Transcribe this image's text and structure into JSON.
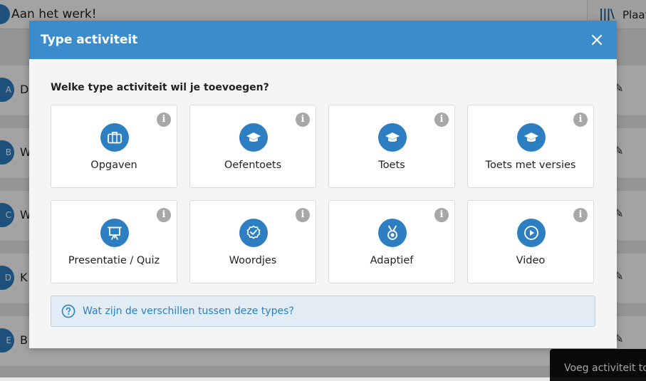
{
  "background": {
    "title": "Aan het werk!",
    "right_panel_label": "Plaat",
    "right_panel_icon": "library-icon",
    "rows": [
      {
        "initial": "A",
        "text": "D"
      },
      {
        "initial": "B",
        "text": "W"
      },
      {
        "initial": "C",
        "text": "W"
      },
      {
        "initial": "D",
        "text": "K"
      },
      {
        "initial": "E",
        "text": "B"
      }
    ],
    "toast": "Voeg activiteit to"
  },
  "modal": {
    "title": "Type activiteit",
    "close_icon": "close-icon",
    "question": "Welke type activiteit wil je toevoegen?",
    "cards": [
      {
        "label": "Opgaven",
        "icon": "briefcase-icon"
      },
      {
        "label": "Oefentoets",
        "icon": "graduation-cap-icon"
      },
      {
        "label": "Toets",
        "icon": "graduation-cap-icon"
      },
      {
        "label": "Toets met versies",
        "icon": "graduation-cap-icon"
      },
      {
        "label": "Presentatie / Quiz",
        "icon": "presentation-board-icon"
      },
      {
        "label": "Woordjes",
        "icon": "badge-check-icon"
      },
      {
        "label": "Adaptief",
        "icon": "medal-icon"
      },
      {
        "label": "Video",
        "icon": "play-icon"
      }
    ],
    "info_glyph": "i",
    "help_text": "Wat zijn de verschillen tussen deze types?",
    "colors": {
      "header": "#3a8ccc",
      "icon_circle": "#2e7fc1",
      "help_bg": "#e1ecf5",
      "info": "#a8a8a8"
    }
  }
}
